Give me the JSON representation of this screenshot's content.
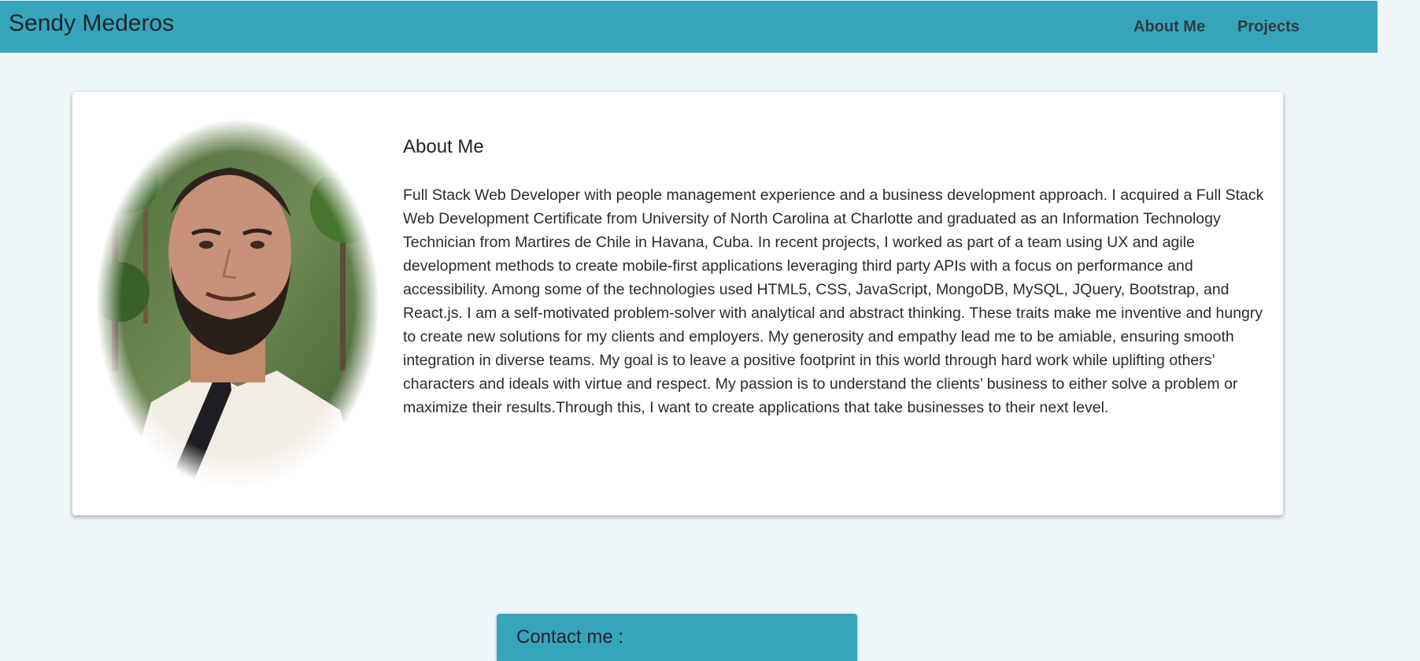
{
  "navbar": {
    "brand": "Sendy Mederos",
    "links": [
      {
        "label": "About Me"
      },
      {
        "label": "Projects"
      }
    ],
    "background_color": "#36a5bc"
  },
  "about": {
    "title": "About Me",
    "photo_icon": "profile-photo",
    "text": "Full Stack Web Developer with people management experience and a business development approach. I acquired a Full Stack Web Development Certificate from University of North Carolina at Charlotte and graduated as an Information Technology Technician from Martires de Chile in Havana, Cuba. In recent projects, I worked as part of a team using UX and agile development methods to create mobile-first applications leveraging third party APIs with a focus on performance and accessibility. Among some of the technologies used HTML5, CSS, JavaScript, MongoDB, MySQL, JQuery, Bootstrap, and React.js. I am a self-motivated problem-solver with analytical and abstract thinking. These traits make me inventive and hungry to create new solutions for my clients and employers. My generosity and empathy lead me to be amiable, ensuring smooth integration in diverse teams. My goal is to leave a positive footprint in this world through hard work while uplifting others’ characters and ideals with virtue and respect. My passion is to understand the clients’ business to either solve a problem or maximize their results.Through this, I want to create applications that take businesses to their next level."
  },
  "contact": {
    "title": "Contact me :"
  },
  "colors": {
    "page_background": "#eef6f8",
    "accent": "#36a5bc"
  }
}
